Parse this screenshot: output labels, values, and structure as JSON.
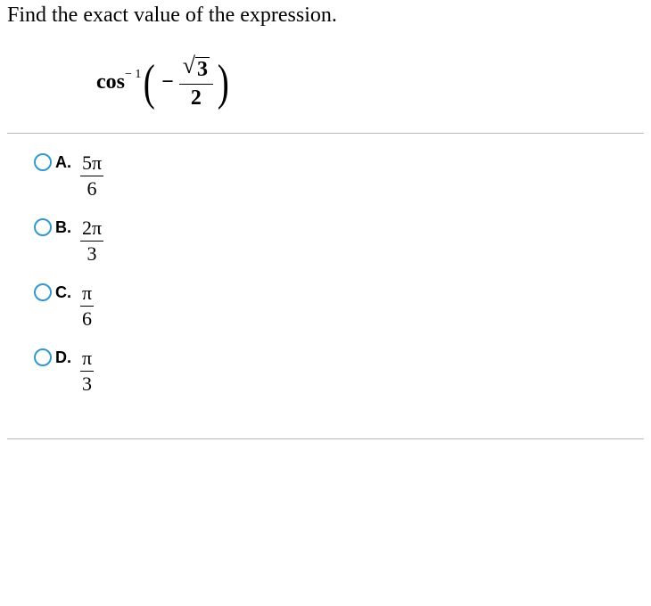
{
  "question": "Find the exact value of the expression.",
  "expression": {
    "func": "cos",
    "super": "− 1",
    "leftParen": "(",
    "minus": "−",
    "sqrt_sign": "√",
    "sqrt_content": "3",
    "denominator": "2",
    "rightParen": ")"
  },
  "choices": [
    {
      "label": "A.",
      "num": "5π",
      "den": "6"
    },
    {
      "label": "B.",
      "num": "2π",
      "den": "3"
    },
    {
      "label": "C.",
      "num": "π",
      "den": "6"
    },
    {
      "label": "D.",
      "num": "π",
      "den": "3"
    }
  ]
}
